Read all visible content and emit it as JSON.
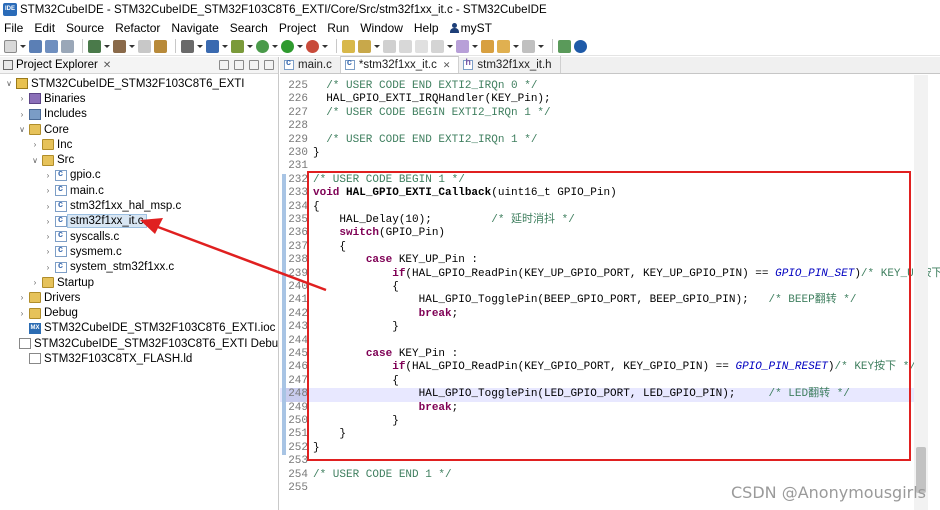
{
  "window": {
    "app_icon_text": "IDE",
    "title": "STM32CubeIDE - STM32CubeIDE_STM32F103C8T6_EXTI/Core/Src/stm32f1xx_it.c - STM32CubeIDE"
  },
  "menu": [
    "File",
    "Edit",
    "Source",
    "Refactor",
    "Navigate",
    "Search",
    "Project",
    "Run",
    "Window",
    "Help",
    "myST"
  ],
  "explorer": {
    "title": "Project Explorer",
    "tree": [
      {
        "label": "STM32CubeIDE_STM32F103C8T6_EXTI",
        "indent": 0,
        "twisty": "∨",
        "icon": "project"
      },
      {
        "label": "Binaries",
        "indent": 1,
        "twisty": "›",
        "icon": "lib"
      },
      {
        "label": "Includes",
        "indent": 1,
        "twisty": "›",
        "icon": "inc"
      },
      {
        "label": "Core",
        "indent": 1,
        "twisty": "∨",
        "icon": "folder"
      },
      {
        "label": "Inc",
        "indent": 2,
        "twisty": "›",
        "icon": "folder"
      },
      {
        "label": "Src",
        "indent": 2,
        "twisty": "∨",
        "icon": "folder"
      },
      {
        "label": "gpio.c",
        "indent": 3,
        "twisty": "›",
        "icon": "cfile"
      },
      {
        "label": "main.c",
        "indent": 3,
        "twisty": "›",
        "icon": "cfile"
      },
      {
        "label": "stm32f1xx_hal_msp.c",
        "indent": 3,
        "twisty": "›",
        "icon": "cfile"
      },
      {
        "label": "stm32f1xx_it.c",
        "indent": 3,
        "twisty": "›",
        "icon": "cfile",
        "selected": true
      },
      {
        "label": "syscalls.c",
        "indent": 3,
        "twisty": "›",
        "icon": "cfile"
      },
      {
        "label": "sysmem.c",
        "indent": 3,
        "twisty": "›",
        "icon": "cfile"
      },
      {
        "label": "system_stm32f1xx.c",
        "indent": 3,
        "twisty": "›",
        "icon": "cfile"
      },
      {
        "label": "Startup",
        "indent": 2,
        "twisty": "›",
        "icon": "folder"
      },
      {
        "label": "Drivers",
        "indent": 1,
        "twisty": "›",
        "icon": "folder"
      },
      {
        "label": "Debug",
        "indent": 1,
        "twisty": "›",
        "icon": "folder"
      },
      {
        "label": "STM32CubeIDE_STM32F103C8T6_EXTI.ioc",
        "indent": 1,
        "twisty": "",
        "icon": "mx"
      },
      {
        "label": "STM32CubeIDE_STM32F103C8T6_EXTI Debug.launch",
        "indent": 1,
        "twisty": "",
        "icon": "doc"
      },
      {
        "label": "STM32F103C8TX_FLASH.ld",
        "indent": 1,
        "twisty": "",
        "icon": "doc"
      }
    ]
  },
  "tabs": [
    {
      "label": "main.c",
      "icon": "c",
      "active": false
    },
    {
      "label": "*stm32f1xx_it.c",
      "icon": "c",
      "active": true
    },
    {
      "label": "stm32f1xx_it.h",
      "icon": "h",
      "active": false
    }
  ],
  "code_lines": [
    {
      "n": "225",
      "segs": [
        [
          "cm",
          "  /* USER CODE END EXTI2_IRQn 0 */"
        ]
      ]
    },
    {
      "n": "226",
      "segs": [
        [
          "",
          "  HAL_GPIO_EXTI_IRQHandler(KEY_Pin);"
        ]
      ]
    },
    {
      "n": "227",
      "segs": [
        [
          "cm",
          "  /* USER CODE BEGIN EXTI2_IRQn 1 */"
        ]
      ]
    },
    {
      "n": "228",
      "segs": []
    },
    {
      "n": "229",
      "segs": [
        [
          "cm",
          "  /* USER CODE END EXTI2_IRQn 1 */"
        ]
      ]
    },
    {
      "n": "230",
      "segs": [
        [
          "",
          "}"
        ]
      ]
    },
    {
      "n": "231",
      "segs": []
    },
    {
      "n": "232",
      "segs": [
        [
          "cm",
          "/* USER CODE BEGIN 1 */"
        ]
      ]
    },
    {
      "n": "233",
      "segs": [
        [
          "kw",
          "void"
        ],
        [
          "",
          " "
        ],
        [
          "fn-def",
          "HAL_GPIO_EXTI_Callback"
        ],
        [
          "",
          "(uint16_t GPIO_Pin)"
        ]
      ]
    },
    {
      "n": "234",
      "segs": [
        [
          "",
          "{"
        ]
      ]
    },
    {
      "n": "235",
      "segs": [
        [
          "",
          "    HAL_Delay(10);         "
        ],
        [
          "cm",
          "/* 延时消抖 */"
        ]
      ]
    },
    {
      "n": "236",
      "segs": [
        [
          "",
          "    "
        ],
        [
          "kw",
          "switch"
        ],
        [
          "",
          "(GPIO_Pin)"
        ]
      ]
    },
    {
      "n": "237",
      "segs": [
        [
          "",
          "    {"
        ]
      ]
    },
    {
      "n": "238",
      "segs": [
        [
          "",
          "        "
        ],
        [
          "kw",
          "case"
        ],
        [
          "",
          " KEY_UP_Pin :"
        ]
      ]
    },
    {
      "n": "239",
      "segs": [
        [
          "",
          "            "
        ],
        [
          "kw",
          "if"
        ],
        [
          "",
          "(HAL_GPIO_ReadPin(KEY_UP_GPIO_PORT, KEY_UP_GPIO_PIN) == "
        ],
        [
          "it",
          "GPIO_PIN_SET"
        ],
        [
          "",
          ")"
        ],
        [
          "cm",
          "/* KEY_UP按下 */"
        ]
      ]
    },
    {
      "n": "240",
      "segs": [
        [
          "",
          "            {"
        ]
      ]
    },
    {
      "n": "241",
      "segs": [
        [
          "",
          "                HAL_GPIO_TogglePin(BEEP_GPIO_PORT, BEEP_GPIO_PIN);   "
        ],
        [
          "cm",
          "/* BEEP翻转 */"
        ]
      ]
    },
    {
      "n": "242",
      "segs": [
        [
          "",
          "                "
        ],
        [
          "kw",
          "break"
        ],
        [
          "",
          ";"
        ]
      ]
    },
    {
      "n": "243",
      "segs": [
        [
          "",
          "            }"
        ]
      ]
    },
    {
      "n": "244",
      "segs": []
    },
    {
      "n": "245",
      "segs": [
        [
          "",
          "        "
        ],
        [
          "kw",
          "case"
        ],
        [
          "",
          " KEY_Pin :"
        ]
      ]
    },
    {
      "n": "246",
      "segs": [
        [
          "",
          "            "
        ],
        [
          "kw",
          "if"
        ],
        [
          "",
          "(HAL_GPIO_ReadPin(KEY_GPIO_PORT, KEY_GPIO_PIN) == "
        ],
        [
          "it",
          "GPIO_PIN_RESET"
        ],
        [
          "",
          ")"
        ],
        [
          "cm",
          "/* KEY按下 */"
        ]
      ]
    },
    {
      "n": "247",
      "segs": [
        [
          "",
          "            {"
        ]
      ]
    },
    {
      "n": "248",
      "segs": [
        [
          "",
          "                HAL_GPIO_TogglePin(LED_GPIO_PORT, LED_GPIO_PIN);     "
        ],
        [
          "cm",
          "/* LED翻转 */"
        ]
      ],
      "hl": true
    },
    {
      "n": "249",
      "segs": [
        [
          "",
          "                "
        ],
        [
          "kw",
          "break"
        ],
        [
          "",
          ";"
        ]
      ]
    },
    {
      "n": "250",
      "segs": [
        [
          "",
          "            }"
        ]
      ]
    },
    {
      "n": "251",
      "segs": [
        [
          "",
          "    }"
        ]
      ]
    },
    {
      "n": "252",
      "segs": [
        [
          "",
          "}"
        ]
      ]
    },
    {
      "n": "253",
      "segs": []
    },
    {
      "n": "254",
      "segs": [
        [
          "cm",
          "/* USER CODE END 1 */"
        ]
      ]
    },
    {
      "n": "255",
      "segs": []
    }
  ],
  "watermark": "CSDN @Anonymousgirls",
  "colors": {
    "annotation": "#e02020",
    "comment": "#3f7f5f",
    "keyword": "#7f0055",
    "constant": "#0000c0"
  }
}
